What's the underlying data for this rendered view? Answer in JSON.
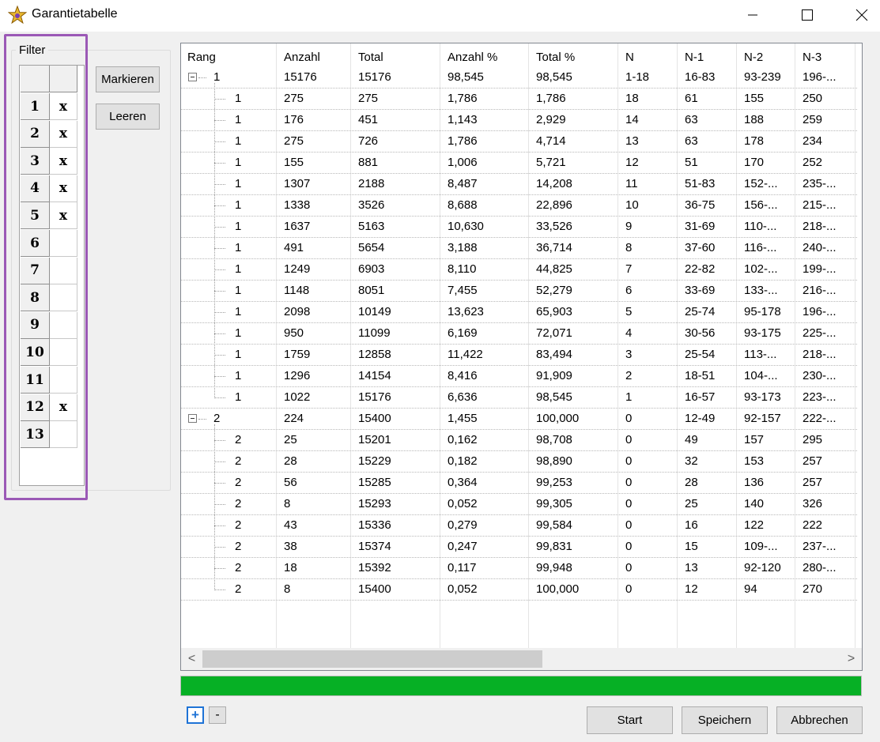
{
  "window": {
    "title": "Garantietabelle",
    "icon": "star-icon"
  },
  "filter": {
    "legend": "Filter",
    "rows": [
      {
        "num": "1",
        "mark": "x"
      },
      {
        "num": "2",
        "mark": "x"
      },
      {
        "num": "3",
        "mark": "x"
      },
      {
        "num": "4",
        "mark": "x"
      },
      {
        "num": "5",
        "mark": "x"
      },
      {
        "num": "6",
        "mark": ""
      },
      {
        "num": "7",
        "mark": ""
      },
      {
        "num": "8",
        "mark": ""
      },
      {
        "num": "9",
        "mark": ""
      },
      {
        "num": "10",
        "mark": ""
      },
      {
        "num": "11",
        "mark": ""
      },
      {
        "num": "12",
        "mark": "x"
      },
      {
        "num": "13",
        "mark": ""
      }
    ],
    "markieren_label": "Markieren",
    "leeren_label": "Leeren"
  },
  "table": {
    "columns": [
      "Rang",
      "Anzahl",
      "Total",
      "Anzahl %",
      "Total %",
      "N",
      "N-1",
      "N-2",
      "N-3"
    ],
    "rows": [
      {
        "level": 0,
        "cells": [
          "1",
          "15176",
          "15176",
          "98,545",
          "98,545",
          "1-18",
          "16-83",
          "93-239",
          "196-..."
        ]
      },
      {
        "level": 1,
        "cells": [
          "1",
          "275",
          "275",
          "1,786",
          "1,786",
          "18",
          "61",
          "155",
          "250"
        ]
      },
      {
        "level": 1,
        "cells": [
          "1",
          "176",
          "451",
          "1,143",
          "2,929",
          "14",
          "63",
          "188",
          "259"
        ]
      },
      {
        "level": 1,
        "cells": [
          "1",
          "275",
          "726",
          "1,786",
          "4,714",
          "13",
          "63",
          "178",
          "234"
        ]
      },
      {
        "level": 1,
        "cells": [
          "1",
          "155",
          "881",
          "1,006",
          "5,721",
          "12",
          "51",
          "170",
          "252"
        ]
      },
      {
        "level": 1,
        "cells": [
          "1",
          "1307",
          "2188",
          "8,487",
          "14,208",
          "11",
          "51-83",
          "152-...",
          "235-..."
        ]
      },
      {
        "level": 1,
        "cells": [
          "1",
          "1338",
          "3526",
          "8,688",
          "22,896",
          "10",
          "36-75",
          "156-...",
          "215-..."
        ]
      },
      {
        "level": 1,
        "cells": [
          "1",
          "1637",
          "5163",
          "10,630",
          "33,526",
          "9",
          "31-69",
          "110-...",
          "218-..."
        ]
      },
      {
        "level": 1,
        "cells": [
          "1",
          "491",
          "5654",
          "3,188",
          "36,714",
          "8",
          "37-60",
          "116-...",
          "240-..."
        ]
      },
      {
        "level": 1,
        "cells": [
          "1",
          "1249",
          "6903",
          "8,110",
          "44,825",
          "7",
          "22-82",
          "102-...",
          "199-..."
        ]
      },
      {
        "level": 1,
        "cells": [
          "1",
          "1148",
          "8051",
          "7,455",
          "52,279",
          "6",
          "33-69",
          "133-...",
          "216-..."
        ]
      },
      {
        "level": 1,
        "cells": [
          "1",
          "2098",
          "10149",
          "13,623",
          "65,903",
          "5",
          "25-74",
          "95-178",
          "196-..."
        ]
      },
      {
        "level": 1,
        "cells": [
          "1",
          "950",
          "11099",
          "6,169",
          "72,071",
          "4",
          "30-56",
          "93-175",
          "225-..."
        ]
      },
      {
        "level": 1,
        "cells": [
          "1",
          "1759",
          "12858",
          "11,422",
          "83,494",
          "3",
          "25-54",
          "113-...",
          "218-..."
        ]
      },
      {
        "level": 1,
        "cells": [
          "1",
          "1296",
          "14154",
          "8,416",
          "91,909",
          "2",
          "18-51",
          "104-...",
          "230-..."
        ]
      },
      {
        "level": 1,
        "cells": [
          "1",
          "1022",
          "15176",
          "6,636",
          "98,545",
          "1",
          "16-57",
          "93-173",
          "223-..."
        ]
      },
      {
        "level": 0,
        "cells": [
          "2",
          "224",
          "15400",
          "1,455",
          "100,000",
          "0",
          "12-49",
          "92-157",
          "222-..."
        ]
      },
      {
        "level": 1,
        "cells": [
          "2",
          "25",
          "15201",
          "0,162",
          "98,708",
          "0",
          "49",
          "157",
          "295"
        ]
      },
      {
        "level": 1,
        "cells": [
          "2",
          "28",
          "15229",
          "0,182",
          "98,890",
          "0",
          "32",
          "153",
          "257"
        ]
      },
      {
        "level": 1,
        "cells": [
          "2",
          "56",
          "15285",
          "0,364",
          "99,253",
          "0",
          "28",
          "136",
          "257"
        ]
      },
      {
        "level": 1,
        "cells": [
          "2",
          "8",
          "15293",
          "0,052",
          "99,305",
          "0",
          "25",
          "140",
          "326"
        ]
      },
      {
        "level": 1,
        "cells": [
          "2",
          "43",
          "15336",
          "0,279",
          "99,584",
          "0",
          "16",
          "122",
          "222"
        ]
      },
      {
        "level": 1,
        "cells": [
          "2",
          "38",
          "15374",
          "0,247",
          "99,831",
          "0",
          "15",
          "109-...",
          "237-..."
        ]
      },
      {
        "level": 1,
        "cells": [
          "2",
          "18",
          "15392",
          "0,117",
          "99,948",
          "0",
          "13",
          "92-120",
          "280-..."
        ]
      },
      {
        "level": 1,
        "cells": [
          "2",
          "8",
          "15400",
          "0,052",
          "100,000",
          "0",
          "12",
          "94",
          "270"
        ]
      }
    ]
  },
  "scroll": {
    "left": "<",
    "right": ">"
  },
  "progress": {
    "fraction": 1.0,
    "color": "#06b025"
  },
  "zoom": {
    "plus": "+",
    "minus": "-"
  },
  "buttons": {
    "start": "Start",
    "speichern": "Speichern",
    "abbrechen": "Abbrechen"
  }
}
